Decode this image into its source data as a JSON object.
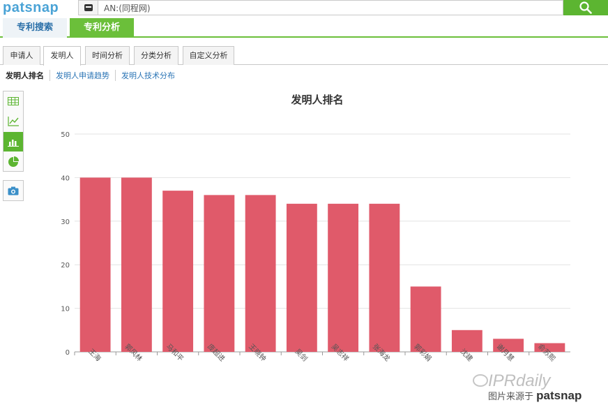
{
  "header": {
    "logo": "patsnap",
    "search_value": "AN:(同程网)"
  },
  "main_tabs": [
    {
      "label": "专利搜索"
    },
    {
      "label": "专利分析"
    }
  ],
  "sub_tabs": [
    {
      "label": "申请人"
    },
    {
      "label": "发明人"
    },
    {
      "label": "时间分析"
    },
    {
      "label": "分类分析"
    },
    {
      "label": "自定义分析"
    }
  ],
  "links": [
    {
      "label": "发明人排名"
    },
    {
      "label": "发明人申请趋势"
    },
    {
      "label": "发明人技术分布"
    }
  ],
  "sidebar": {
    "icons": [
      "table-icon",
      "line-chart-icon",
      "bar-chart-icon",
      "pie-chart-icon",
      "camera-icon"
    ]
  },
  "colors": {
    "bar": "#e05a6a",
    "accent": "#5cb531",
    "link": "#2a74b5"
  },
  "chart_data": {
    "type": "bar",
    "title": "发明人排名",
    "categories": [
      "王海",
      "郭风林",
      "马和平",
      "庞超进",
      "王晓钟",
      "吴剑",
      "吴志祥",
      "张海龙",
      "郭彩娟",
      "沈建",
      "谢月慧",
      "俞苏熙"
    ],
    "values": [
      40,
      40,
      37,
      36,
      36,
      34,
      34,
      34,
      15,
      5,
      3,
      2
    ],
    "ylim": [
      0,
      50
    ],
    "yticks": [
      "0",
      "10",
      "20",
      "30",
      "40",
      "50"
    ],
    "xlabel": "",
    "ylabel": "",
    "grid": true
  },
  "watermark": {
    "brand": "IPRdaily",
    "source_prefix": "图片来源于",
    "source_brand": "patsnap"
  }
}
